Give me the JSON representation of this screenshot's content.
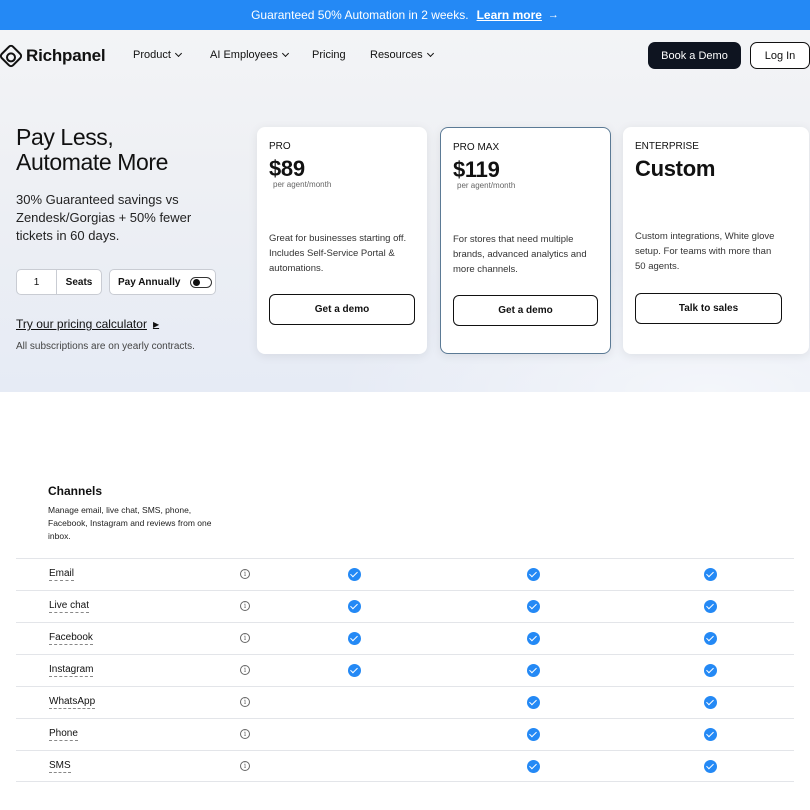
{
  "banner": {
    "text": "Guaranteed 50% Automation in 2 weeks.",
    "link": "Learn more",
    "arrow": "→"
  },
  "brand": {
    "name": "Richpanel"
  },
  "nav": {
    "items": [
      "Product",
      "AI Employees",
      "Pricing",
      "Resources"
    ],
    "book_demo": "Book a Demo",
    "login": "Log In"
  },
  "hero": {
    "title_line1": "Pay Less,",
    "title_line2": "Automate More",
    "subtitle": "30% Guaranteed savings vs Zendesk/Gorgias + 50% fewer tickets in 60 days.",
    "seats_value": "1",
    "seats_label": "Seats",
    "pay_annually": "Pay Annually",
    "calculator_link": "Try our pricing calculator",
    "contracts_note": "All subscriptions are on yearly contracts."
  },
  "plans": [
    {
      "name": "PRO",
      "price": "$89",
      "per": "per agent/month",
      "desc": "Great for businesses starting off. Includes Self-Service Portal & automations.",
      "button": "Get a demo"
    },
    {
      "name": "PRO MAX",
      "price": "$119",
      "per": "per agent/month",
      "desc": "For stores that need multiple brands, advanced analytics and more channels.",
      "button": "Get a demo"
    },
    {
      "name": "ENTERPRISE",
      "price": "Custom",
      "per": "",
      "desc": "Custom integrations, White glove setup. For teams with more than 50 agents.",
      "button": "Talk to sales"
    }
  ],
  "channels": {
    "title": "Channels",
    "desc": "Manage email, live chat, SMS, phone, Facebook, Instagram and reviews from one inbox.",
    "rows": [
      {
        "label": "Email",
        "pro": true,
        "promax": true,
        "enterprise": true
      },
      {
        "label": "Live chat",
        "pro": true,
        "promax": true,
        "enterprise": true
      },
      {
        "label": "Facebook",
        "pro": true,
        "promax": true,
        "enterprise": true
      },
      {
        "label": "Instagram",
        "pro": true,
        "promax": true,
        "enterprise": true
      },
      {
        "label": "WhatsApp",
        "pro": false,
        "promax": true,
        "enterprise": true
      },
      {
        "label": "Phone",
        "pro": false,
        "promax": true,
        "enterprise": true
      },
      {
        "label": "SMS",
        "pro": false,
        "promax": true,
        "enterprise": true
      }
    ]
  },
  "colors": {
    "accent": "#2489f5",
    "dark_button": "#0e1420",
    "promax_border": "#5b7a95"
  }
}
